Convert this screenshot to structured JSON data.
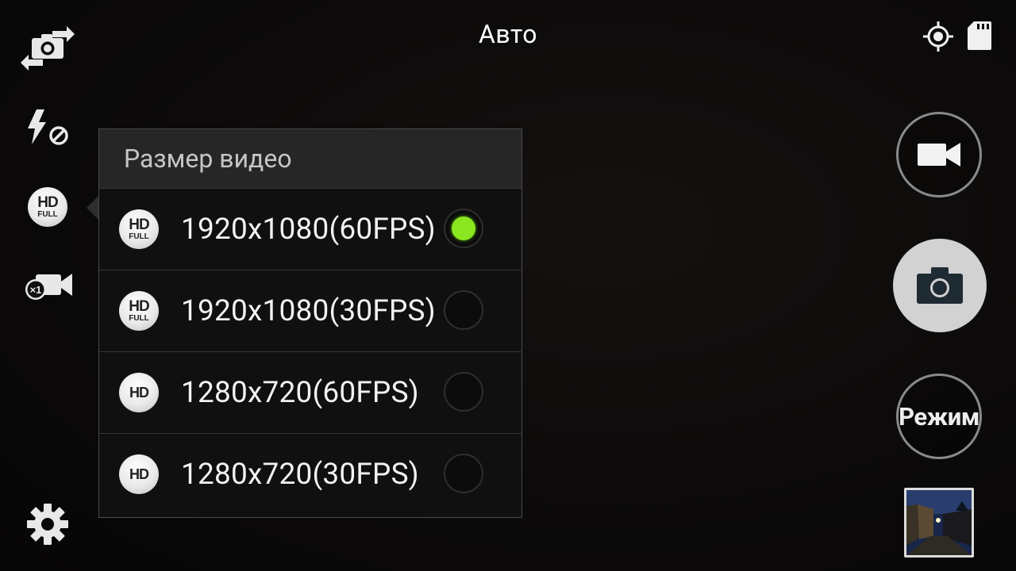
{
  "header": {
    "mode_title": "Авто"
  },
  "left_toolbar": {
    "items": [
      {
        "icon": "switch-camera-icon"
      },
      {
        "icon": "flash-off-icon"
      },
      {
        "icon": "video-size-icon",
        "badge_top": "HD",
        "badge_bottom": "FULL"
      },
      {
        "icon": "recording-mode-icon",
        "badge": "×1"
      },
      {
        "icon": "gear-icon"
      }
    ]
  },
  "popup": {
    "title": "Размер видео",
    "options": [
      {
        "badge_top": "HD",
        "badge_bottom": "FULL",
        "label": "1920x1080(60FPS)",
        "selected": true
      },
      {
        "badge_top": "HD",
        "badge_bottom": "FULL",
        "label": "1920x1080(30FPS)",
        "selected": false
      },
      {
        "badge_top": "HD",
        "badge_bottom": "",
        "label": "1280x720(60FPS)",
        "selected": false
      },
      {
        "badge_top": "HD",
        "badge_bottom": "",
        "label": "1280x720(30FPS)",
        "selected": false
      }
    ]
  },
  "right_toolbar": {
    "status_icons": [
      "gps-icon",
      "sd-card-icon"
    ],
    "record_icon": "video-camera-icon",
    "shutter_icon": "camera-icon",
    "mode_label": "Режим",
    "gallery": "gallery-thumbnail"
  },
  "colors": {
    "accent_selected": "#8ae61f",
    "background": "#0b0909",
    "popup_header": "#262626"
  }
}
